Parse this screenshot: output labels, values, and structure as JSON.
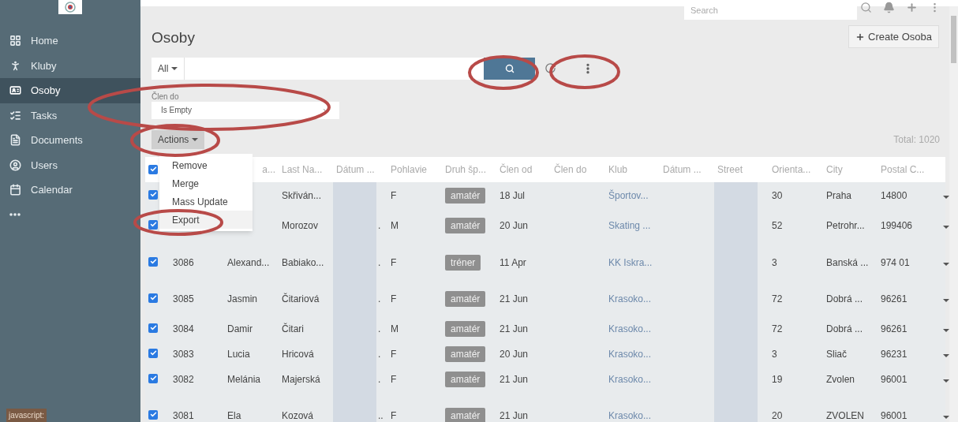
{
  "sidebar": {
    "items": [
      {
        "label": "Home",
        "selected": false
      },
      {
        "label": "Kluby",
        "selected": false
      },
      {
        "label": "Osoby",
        "selected": true
      },
      {
        "label": "Tasks",
        "selected": false
      },
      {
        "label": "Documents",
        "selected": false
      },
      {
        "label": "Users",
        "selected": false
      },
      {
        "label": "Calendar",
        "selected": false
      }
    ]
  },
  "top_search": {
    "placeholder": "Search"
  },
  "title": "Osoby",
  "create_button": "Create Osoba",
  "search": {
    "scope": "All"
  },
  "filter": {
    "label": "Člen do",
    "value": "Is Empty"
  },
  "actions": {
    "label": "Actions",
    "menu": [
      {
        "label": "Remove",
        "selected": false
      },
      {
        "label": "Merge",
        "selected": false
      },
      {
        "label": "Mass Update",
        "selected": false
      },
      {
        "label": "Export",
        "selected": true
      }
    ]
  },
  "total": "Total: 1020",
  "table": {
    "header_checked": true,
    "columns": [
      "a...",
      "Last Na...",
      "Dátum ...",
      "Pohlavie",
      "Druh šp...",
      "Člen od",
      "Člen do",
      "Klub",
      "Dátum ...",
      "Street",
      "Orienta...",
      "City",
      "Postal C..."
    ],
    "rows": [
      {
        "checked": true,
        "id": "",
        "first_name": "",
        "last_name": "Skřiván...",
        "datum": "",
        "pohlavie": "F",
        "druh": "amatér",
        "clen_od": "18 Jul",
        "klub": "Športov...",
        "orienta": "30",
        "city": "Praha",
        "postal": "14800"
      },
      {
        "checked": true,
        "id": "",
        "first_name": "",
        "last_name": "Morozov",
        "datum": ".",
        "pohlavie": "M",
        "druh": "amatér",
        "clen_od": "20 Jun",
        "klub": "Skating ...",
        "orienta": "52",
        "city": "Petrohr...",
        "postal": "199406"
      },
      {
        "checked": true,
        "id": "3086",
        "first_name": "Alexand...",
        "last_name": "Babiako...",
        "datum": ".",
        "pohlavie": "F",
        "druh": "tréner",
        "clen_od": "11 Apr",
        "klub": "KK Iskra...",
        "orienta": "3",
        "city": "Banská ...",
        "postal": "974 01"
      },
      {
        "checked": true,
        "id": "3085",
        "first_name": "Jasmin",
        "last_name": "Čitariová",
        "datum": ".",
        "pohlavie": "F",
        "druh": "amatér",
        "clen_od": "21 Jun",
        "klub": "Krasoko...",
        "orienta": "72",
        "city": "Dobrá ...",
        "postal": "96261"
      },
      {
        "checked": true,
        "id": "3084",
        "first_name": "Damir",
        "last_name": "Čitari",
        "datum": ".",
        "pohlavie": "M",
        "druh": "amatér",
        "clen_od": "21 Jun",
        "klub": "Krasoko...",
        "orienta": "72",
        "city": "Dobrá ...",
        "postal": "96261"
      },
      {
        "checked": true,
        "id": "3083",
        "first_name": "Lucia",
        "last_name": "Hricová",
        "datum": ".",
        "pohlavie": "F",
        "druh": "amatér",
        "clen_od": "20 Jun",
        "klub": "Krasoko...",
        "orienta": "3",
        "city": "Sliač",
        "postal": "96231"
      },
      {
        "checked": true,
        "id": "3082",
        "first_name": "Melánia",
        "last_name": "Majerská",
        "datum": ".",
        "pohlavie": "F",
        "druh": "amatér",
        "clen_od": "21 Jun",
        "klub": "Krasoko...",
        "orienta": "19",
        "city": "Zvolen",
        "postal": "96001"
      },
      {
        "checked": true,
        "id": "3081",
        "first_name": "Ela",
        "last_name": "Kozová",
        "datum": "..",
        "pohlavie": "F",
        "druh": "amatér",
        "clen_od": "21 Jun",
        "klub": "Krasoko...",
        "orienta": "20",
        "city": "ZVOLEN",
        "postal": "96001"
      }
    ]
  },
  "status_tip": "javascript:"
}
